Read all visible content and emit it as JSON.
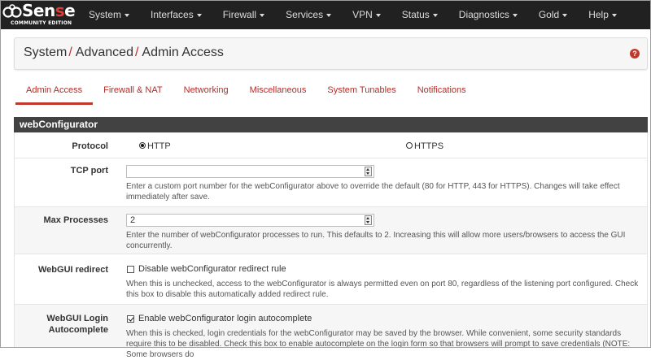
{
  "colors": {
    "navbar_bg": "#212121",
    "accent_red": "#c0392b",
    "section_header_bg": "#424242"
  },
  "brand": {
    "logo_text_start": "Sen",
    "logo_text_highlight": "s",
    "logo_text_end": "e",
    "edition": "COMMUNITY EDITION",
    "icon": "pfsense-logo-icon"
  },
  "nav": {
    "items": [
      {
        "label": "System"
      },
      {
        "label": "Interfaces"
      },
      {
        "label": "Firewall"
      },
      {
        "label": "Services"
      },
      {
        "label": "VPN"
      },
      {
        "label": "Status"
      },
      {
        "label": "Diagnostics"
      },
      {
        "label": "Gold"
      },
      {
        "label": "Help"
      }
    ],
    "caret_icon": "caret-down-icon"
  },
  "breadcrumb": {
    "parts": [
      "System",
      "Advanced",
      "Admin Access"
    ],
    "separator": "/",
    "help_icon": "question-circle-icon",
    "help_glyph": "?"
  },
  "tabs": [
    {
      "label": "Admin Access",
      "active": true
    },
    {
      "label": "Firewall & NAT",
      "active": false
    },
    {
      "label": "Networking",
      "active": false
    },
    {
      "label": "Miscellaneous",
      "active": false
    },
    {
      "label": "System Tunables",
      "active": false
    },
    {
      "label": "Notifications",
      "active": false
    }
  ],
  "section": {
    "title": "webConfigurator"
  },
  "form": {
    "protocol": {
      "label": "Protocol",
      "options": [
        {
          "label": "HTTP",
          "checked": true
        },
        {
          "label": "HTTPS",
          "checked": false
        }
      ]
    },
    "tcp_port": {
      "label": "TCP port",
      "value": "",
      "help": "Enter a custom port number for the webConfigurator above to override the default (80 for HTTP, 443 for HTTPS). Changes will take effect immediately after save."
    },
    "max_processes": {
      "label": "Max Processes",
      "value": "2",
      "help": "Enter the number of webConfigurator processes to run. This defaults to 2. Increasing this will allow more users/browsers to access the GUI concurrently."
    },
    "webgui_redirect": {
      "label": "WebGUI redirect",
      "checkbox_label": "Disable webConfigurator redirect rule",
      "checked": false,
      "help": "When this is unchecked, access to the webConfigurator is always permitted even on port 80, regardless of the listening port configured. Check this box to disable this automatically added redirect rule."
    },
    "login_autocomplete": {
      "label_line1": "WebGUI Login",
      "label_line2": "Autocomplete",
      "checkbox_label": "Enable webConfigurator login autocomplete",
      "checked": true,
      "help": "When this is checked, login credentials for the webConfigurator may be saved by the browser. While convenient, some security standards require this to be disabled. Check this box to enable autocomplete on the login form so that browsers will prompt to save credentials (NOTE: Some browsers do"
    }
  }
}
